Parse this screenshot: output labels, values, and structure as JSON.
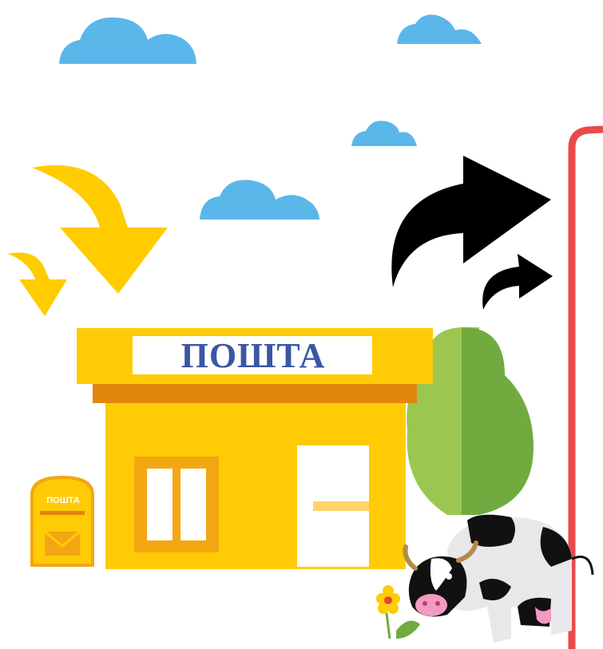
{
  "scene": {
    "post_office_sign": "ПОШТА",
    "mailbox_label": "ПОШТА"
  },
  "colors": {
    "sky_cloud": "#5bb7ea",
    "building": "#ffcb05",
    "building_dark": "#e0860b",
    "arrow_in": "#ffcc00",
    "arrow_out": "#000000",
    "tree_light": "#9bc751",
    "tree_dark": "#71ab3f",
    "frame": "#ea4a4a",
    "sign_text": "#3a56a4"
  },
  "icons": [
    "cloud-icon",
    "incoming-arrow-icon",
    "outgoing-arrow-icon",
    "mailbox-icon",
    "tree-icon",
    "cow-icon",
    "flower-icon"
  ]
}
